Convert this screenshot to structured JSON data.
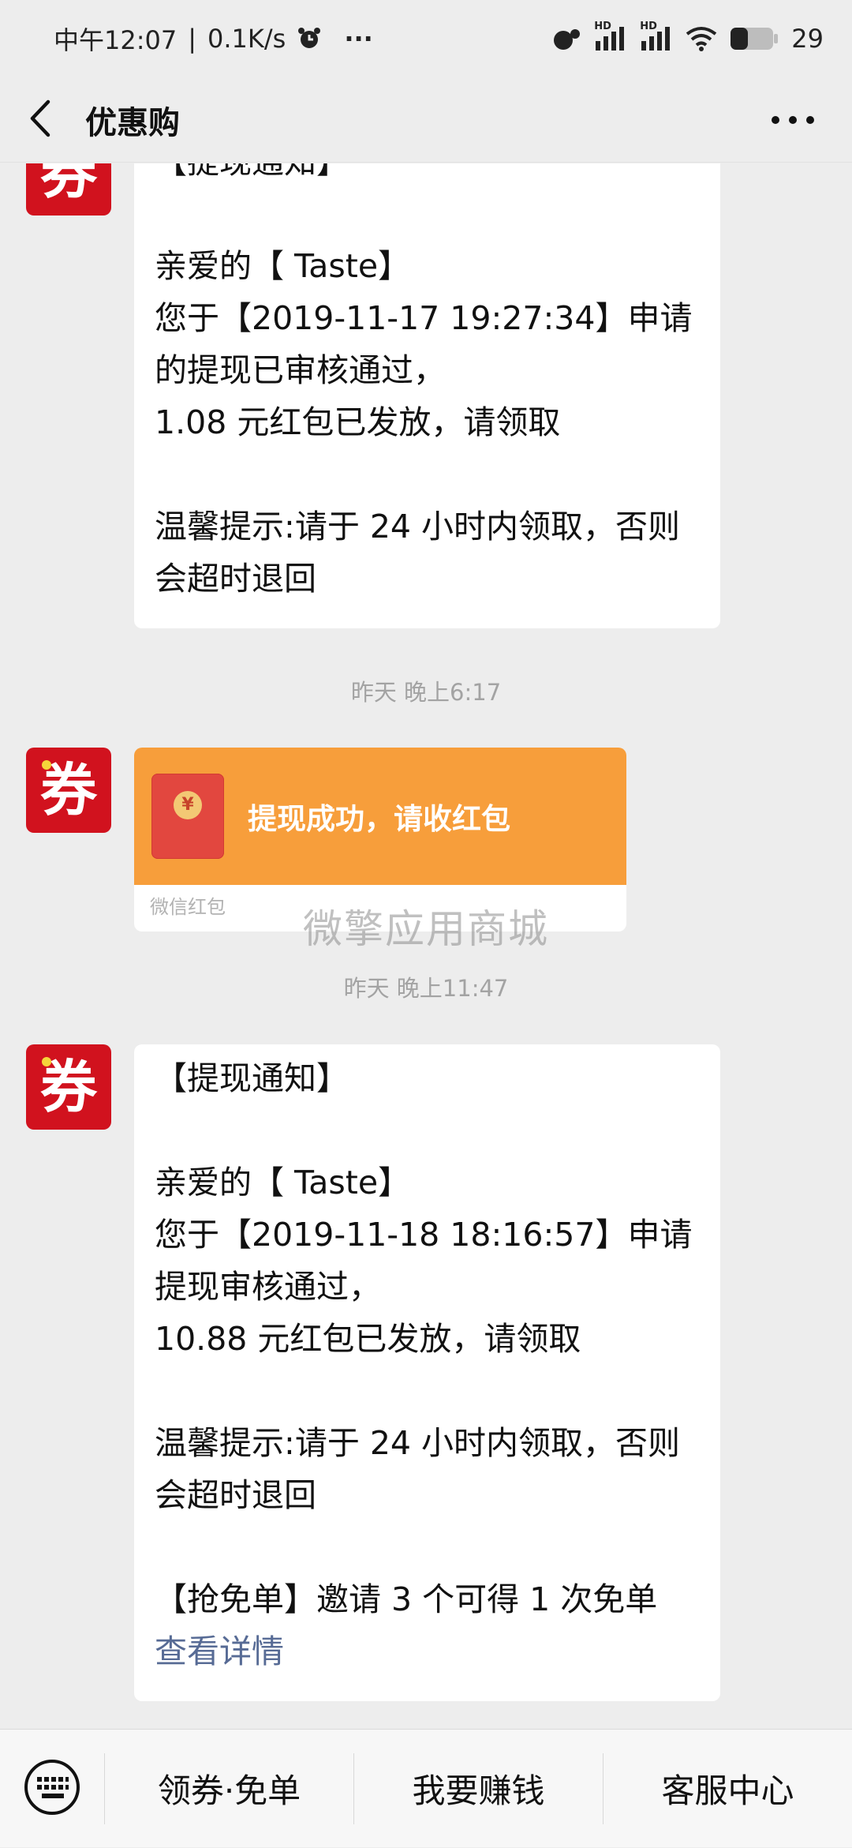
{
  "status_bar": {
    "time": "中午12:07",
    "network_speed": "0.1K/s",
    "dots": "···",
    "hd1": "HD",
    "hd2": "HD",
    "battery": "29"
  },
  "nav": {
    "title": "优惠购"
  },
  "avatar_glyph": "券",
  "messages": [
    {
      "lines": [
        "【提现通知】",
        "",
        "亲爱的【 Taste】",
        "您于【2019-11-17 19:27:34】申请的提现已审核通过，",
        "1.08 元红包已发放，请领取",
        "",
        "温馨提示:请于 24 小时内领取，否则会超时退回"
      ]
    },
    {
      "lines": [
        "【提现通知】",
        "",
        "亲爱的【 Taste】",
        "您于【2019-11-18 18:16:57】申请提现审核通过，",
        "10.88 元红包已发放，请领取",
        "",
        "温馨提示:请于 24 小时内领取，否则会超时退回",
        "",
        "【抢免单】邀请 3 个可得 1 次免单"
      ],
      "link": "查看详情"
    }
  ],
  "timestamps": [
    "昨天 晚上6:17",
    "昨天 晚上11:47"
  ],
  "red_packet": {
    "title": "提现成功，请收红包",
    "source": "微信红包",
    "coin_symbol": "¥"
  },
  "watermark": "微擎应用商城",
  "bottom_menu": {
    "items": [
      "领券·免单",
      "我要赚钱",
      "客服中心"
    ]
  },
  "colors": {
    "brand_red": "#d1121e",
    "red_packet_orange": "#f79e3b",
    "link_blue": "#576b95"
  },
  "icons": [
    "back-arrow-icon",
    "more-dots-icon",
    "keyboard-icon",
    "alarm-icon",
    "signal-icon",
    "wifi-icon",
    "battery-icon"
  ]
}
